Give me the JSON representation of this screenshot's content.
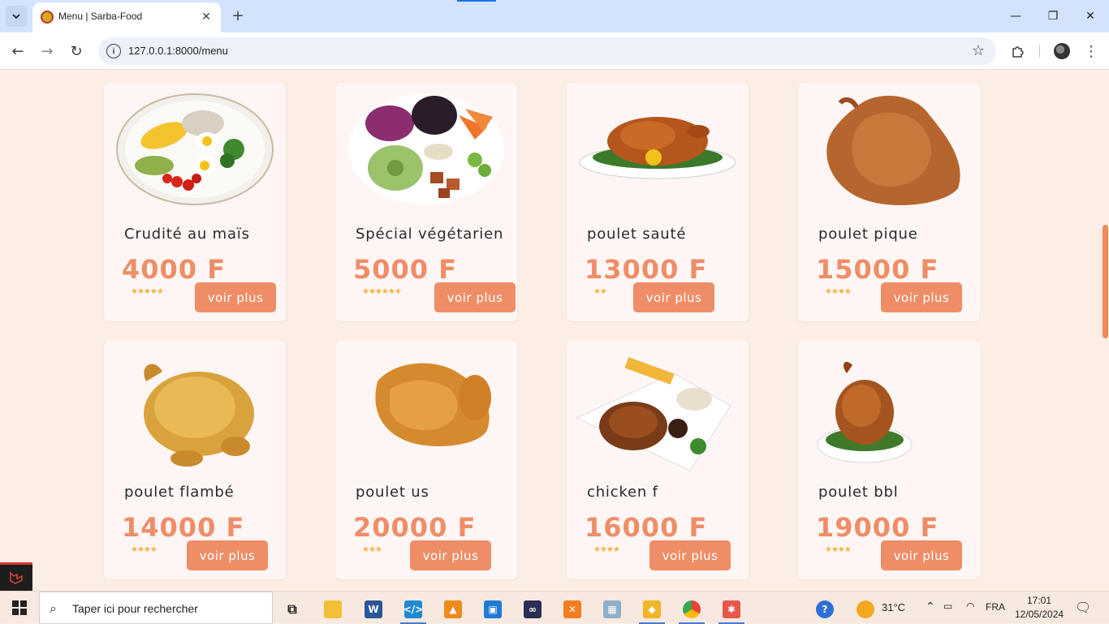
{
  "browser": {
    "tab_title": "Menu | Sarba-Food",
    "url": "127.0.0.1:8000/menu"
  },
  "menu": {
    "button_label": "voir plus",
    "items": [
      {
        "name": "Crudité au maïs",
        "price": "4000 F",
        "stars": "★★★★★",
        "rating": 5
      },
      {
        "name": "Spécial végétarien",
        "price": "5000 F",
        "stars": "★★★★★★",
        "rating": 6
      },
      {
        "name": "poulet sauté",
        "price": "13000 F",
        "stars": "★★",
        "rating": 2
      },
      {
        "name": "poulet pique",
        "price": "15000 F",
        "stars": "★★★★",
        "rating": 4
      },
      {
        "name": "poulet flambé",
        "price": "14000 F",
        "stars": "★★★★",
        "rating": 4
      },
      {
        "name": "poulet us",
        "price": "20000 F",
        "stars": "★★★",
        "rating": 3
      },
      {
        "name": "chicken f",
        "price": "16000 F",
        "stars": "★★★★",
        "rating": 4
      },
      {
        "name": "poulet bbl",
        "price": "19000 F",
        "stars": "★★★★",
        "rating": 4
      }
    ]
  },
  "taskbar": {
    "search_placeholder": "Taper ici pour rechercher",
    "weather": "31°C",
    "language": "FRA",
    "time": "17:01",
    "date": "12/05/2024"
  },
  "colors": {
    "accent": "#ef8d67",
    "page_bg": "#fdeee5",
    "card_bg": "#fdf6f4",
    "star": "#f2b33d"
  }
}
